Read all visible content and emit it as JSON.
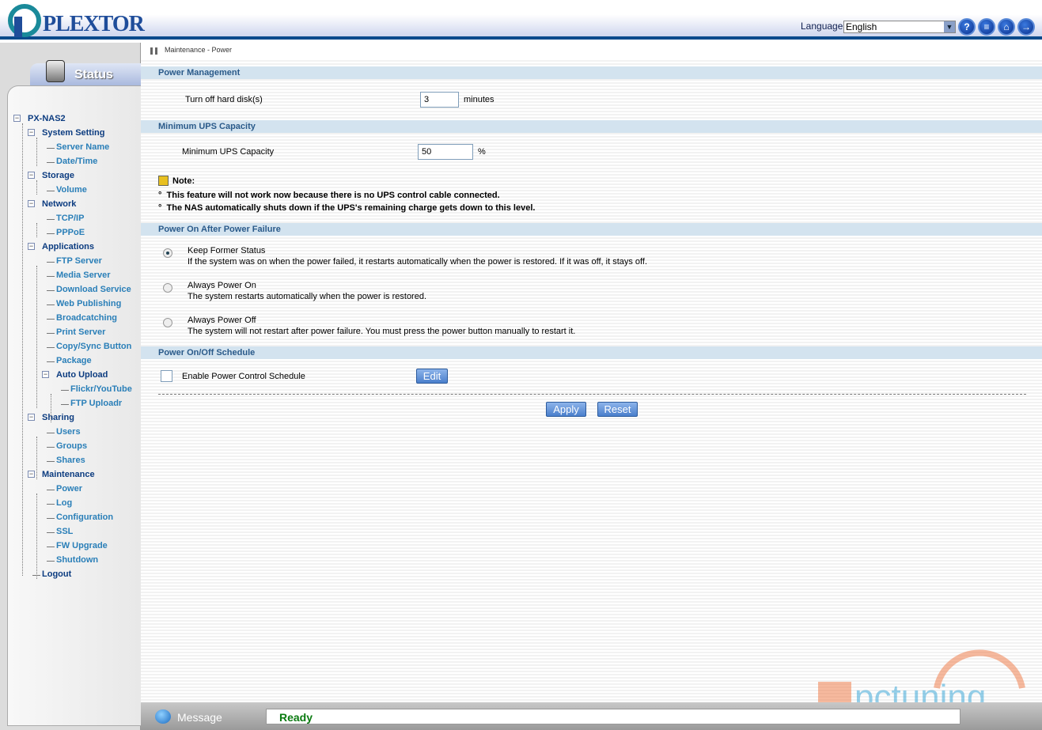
{
  "header": {
    "logo": "PLEXTOR",
    "language_label": "Language:",
    "language_value": "English",
    "icons": [
      "help-icon",
      "notes-icon",
      "home-icon",
      "logout-icon"
    ]
  },
  "sidebar": {
    "status_tab": "Status",
    "tree": [
      {
        "label": "PX-NAS2",
        "level": 0,
        "node": true
      },
      {
        "label": "System Setting",
        "level": 1,
        "node": true
      },
      {
        "label": "Server Name",
        "level": 2
      },
      {
        "label": "Date/Time",
        "level": 2
      },
      {
        "label": "Storage",
        "level": 1,
        "node": true
      },
      {
        "label": "Volume",
        "level": 2
      },
      {
        "label": "Network",
        "level": 1,
        "node": true
      },
      {
        "label": "TCP/IP",
        "level": 2
      },
      {
        "label": "PPPoE",
        "level": 2
      },
      {
        "label": "Applications",
        "level": 1,
        "node": true
      },
      {
        "label": "FTP Server",
        "level": 2
      },
      {
        "label": "Media Server",
        "level": 2
      },
      {
        "label": "Download Service",
        "level": 2
      },
      {
        "label": "Web Publishing",
        "level": 2
      },
      {
        "label": "Broadcatching",
        "level": 2
      },
      {
        "label": "Print Server",
        "level": 2
      },
      {
        "label": "Copy/Sync Button",
        "level": 2
      },
      {
        "label": "Package",
        "level": 2
      },
      {
        "label": "Auto Upload",
        "level": 2,
        "node": true
      },
      {
        "label": "Flickr/YouTube",
        "level": 3
      },
      {
        "label": "FTP Uploadr",
        "level": 3
      },
      {
        "label": "Sharing",
        "level": 1,
        "node": true
      },
      {
        "label": "Users",
        "level": 2
      },
      {
        "label": "Groups",
        "level": 2
      },
      {
        "label": "Shares",
        "level": 2
      },
      {
        "label": "Maintenance",
        "level": 1,
        "node": true
      },
      {
        "label": "Power",
        "level": 2
      },
      {
        "label": "Log",
        "level": 2
      },
      {
        "label": "Configuration",
        "level": 2
      },
      {
        "label": "SSL",
        "level": 2
      },
      {
        "label": "FW Upgrade",
        "level": 2
      },
      {
        "label": "Shutdown",
        "level": 2
      },
      {
        "label": "Logout",
        "level": 1,
        "node": true,
        "leaf": true
      }
    ]
  },
  "main": {
    "breadcrumb": "Maintenance - Power",
    "power_mgmt": {
      "title": "Power Management",
      "label": "Turn off hard disk(s)",
      "value": "3",
      "unit": "minutes"
    },
    "ups": {
      "title": "Minimum UPS Capacity",
      "label": "Minimum UPS Capacity",
      "value": "50",
      "unit": "%"
    },
    "note": {
      "title": "Note:",
      "lines": [
        "This feature will not work now because there is no UPS control cable connected.",
        "The NAS automatically shuts down if the UPS's remaining charge gets down to this level."
      ]
    },
    "power_failure": {
      "title": "Power On After Power Failure",
      "options": [
        {
          "label": "Keep Former Status",
          "desc": "If the system was on when the power failed, it restarts automatically when the power is restored. If it was off, it stays off.",
          "selected": true
        },
        {
          "label": "Always Power On",
          "desc": "The system restarts automatically when the power is restored.",
          "selected": false
        },
        {
          "label": "Always Power Off",
          "desc": "The system will not restart after power failure. You must press the power button manually to restart it.",
          "selected": false
        }
      ]
    },
    "schedule": {
      "title": "Power On/Off Schedule",
      "checkbox_label": "Enable Power Control Schedule",
      "checked": false,
      "edit": "Edit"
    },
    "apply": "Apply",
    "reset": "Reset"
  },
  "footer": {
    "message_label": "Message",
    "status": "Ready"
  },
  "watermark": "pctuning"
}
